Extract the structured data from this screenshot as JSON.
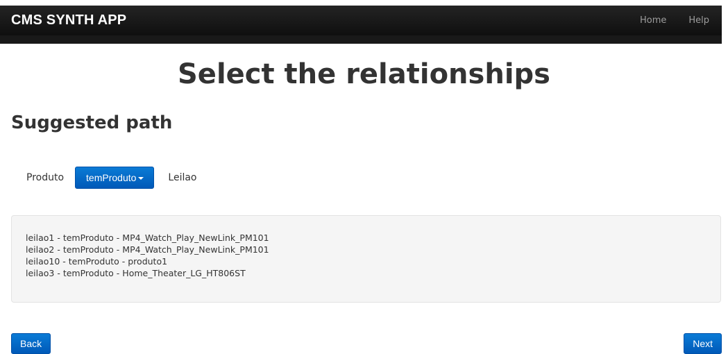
{
  "navbar": {
    "brand": "CMS SYNTH APP",
    "links": [
      "Home",
      "Help"
    ]
  },
  "page": {
    "title": "Select the relationships",
    "section_title": "Suggested path"
  },
  "path": {
    "source": "Produto",
    "relationship": "temProduto",
    "target": "Leilao",
    "accent_color": "#0a6fd0"
  },
  "results": [
    "leilao1 - temProduto - MP4_Watch_Play_NewLink_PM101",
    "leilao2 - temProduto - MP4_Watch_Play_NewLink_PM101",
    "leilao10 - temProduto - produto1",
    "leilao3 - temProduto - Home_Theater_LG_HT806ST"
  ],
  "actions": {
    "back_label": "Back",
    "next_label": "Next"
  }
}
